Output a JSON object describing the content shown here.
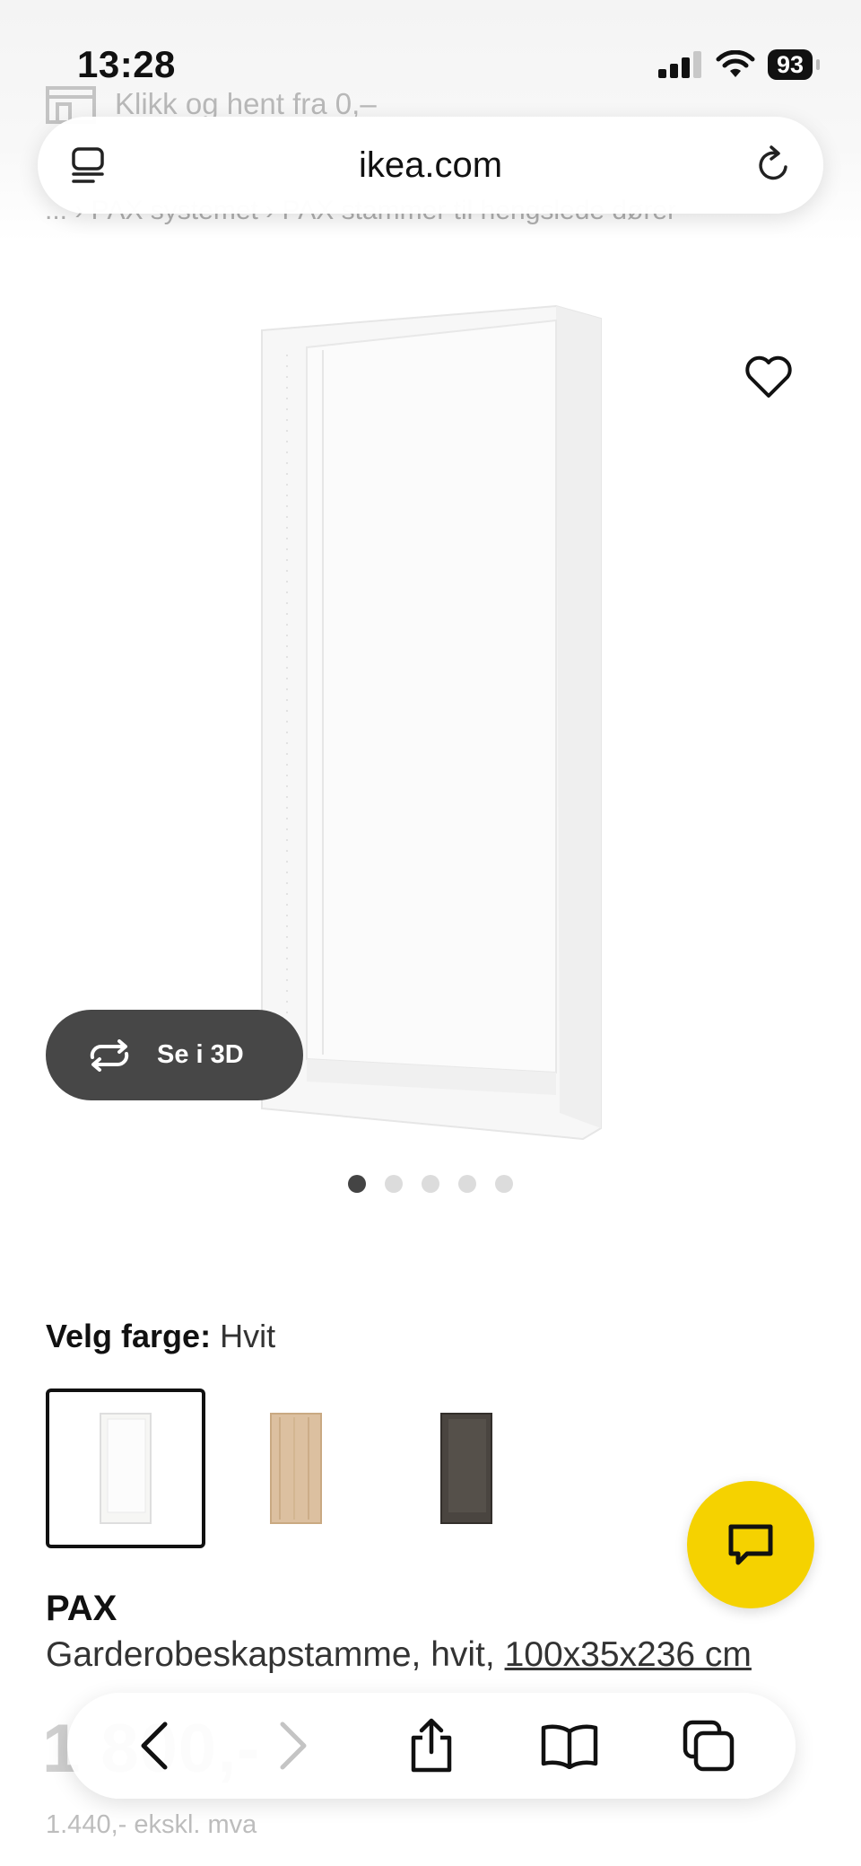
{
  "status_bar": {
    "time": "13:28",
    "battery": "93"
  },
  "page_behind": {
    "promo_text": "Klikk og hent fra 0,–",
    "breadcrumb": "... › PAX systemet › PAX stammer til hengslede dører"
  },
  "browser": {
    "url": "ikea.com"
  },
  "product": {
    "view_3d_label": "Se i 3D",
    "image_count": 5,
    "active_image_index": 0,
    "color_label": "Velg farge:",
    "color_value": "Hvit",
    "swatches": [
      {
        "name": "white",
        "selected": true,
        "color": "#f6f6f4"
      },
      {
        "name": "oak",
        "selected": false,
        "color": "#dcc0a0"
      },
      {
        "name": "dark",
        "selected": false,
        "color": "#4a4540"
      }
    ],
    "name": "PAX",
    "description": "Garderobeskapstamme, hvit, ",
    "dimensions": "100x35x236 cm",
    "price": "1 800,-",
    "price_ex_vat": "1.440,- ekskl. mva"
  },
  "colors": {
    "chat_button": "#f5d200",
    "view3d_button": "#474747"
  }
}
